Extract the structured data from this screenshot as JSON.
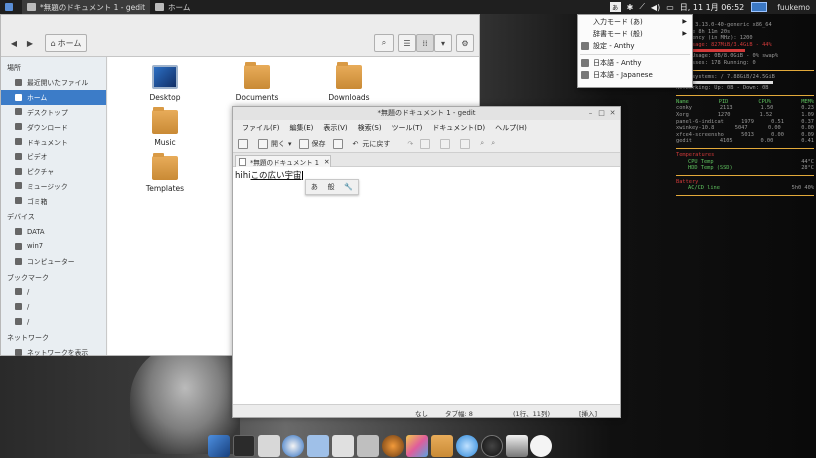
{
  "top_panel": {
    "tasks": [
      {
        "label": "*無題のドキュメント 1 - gedit",
        "active": true
      },
      {
        "label": "ホーム",
        "active": false
      }
    ],
    "ime_indicator": "あ",
    "clock": "日, 11 1月 06:52",
    "user": "fuukemo"
  },
  "ime_menu": {
    "items": [
      {
        "label": "入力モード (あ)",
        "submenu": true
      },
      {
        "label": "辞書モード (般)",
        "submenu": true
      },
      {
        "label": "設定 - Anthy",
        "submenu": false
      },
      {
        "label": "日本語 - Anthy",
        "submenu": false
      },
      {
        "label": "日本語 - Japanese",
        "submenu": false
      }
    ]
  },
  "file_manager": {
    "location_button": "ホーム",
    "sidebar": {
      "sections": [
        {
          "title": "場所",
          "items": [
            "最近開いたファイル",
            "ホーム",
            "デスクトップ",
            "ダウンロード",
            "ドキュメント",
            "ビデオ",
            "ピクチャ",
            "ミュージック",
            "ゴミ箱"
          ]
        },
        {
          "title": "デバイス",
          "items": [
            "DATA",
            "win7",
            "コンピューター"
          ]
        },
        {
          "title": "ブックマーク",
          "items": [
            "/",
            "/",
            "/"
          ]
        },
        {
          "title": "ネットワーク",
          "items": [
            "ネットワークを表示"
          ]
        }
      ],
      "selected": "ホーム"
    },
    "files": [
      "Desktop",
      "Documents",
      "Downloads",
      "Music",
      "Templates"
    ]
  },
  "gedit": {
    "title": "*無題のドキュメント 1 - gedit",
    "menu": [
      "ファイル(F)",
      "編集(E)",
      "表示(V)",
      "検索(S)",
      "ツール(T)",
      "ドキュメント(D)",
      "ヘルプ(H)"
    ],
    "toolbar": {
      "open": "開く",
      "save": "保存",
      "undo": "元に戻す"
    },
    "tab_label": "*無題のドキュメント 1",
    "text_committed": "hihi",
    "text_preedit": "この広い宇宙",
    "ime_popup": [
      "あ",
      "般"
    ],
    "status": {
      "language": "なし",
      "tab_width": "タブ幅: 8",
      "position": "(1行、11列)",
      "mode": "[挿入]"
    }
  },
  "conky": {
    "header": "Linux 3.13.0-40-generic x86_64",
    "lines": [
      "Uptime 8h 11m 20s",
      "Frequency (in MHz): 1200",
      "RAM Usage: 827MiB/3.4GiB - 44%",
      "Swap Usage: 0B/8.0GiB - 0% swap%",
      "Processes: 178  Running: 0"
    ],
    "disk": "File systems: / 7.88GiB/24.5GiB",
    "network": "Networking: Up: 0B  - Down: 0B",
    "procs_header": [
      "Name",
      "PID",
      "CPU%",
      "MEM%"
    ],
    "procs": [
      [
        "conky",
        "2113",
        "1.50",
        "0.23"
      ],
      [
        "Xorg",
        "1270",
        "1.52",
        "1.09"
      ],
      [
        "panel-6-indicat",
        "1979",
        "0.51",
        "0.37"
      ],
      [
        "xwinkey-10.8",
        "5047",
        "0.00",
        "0.00"
      ],
      [
        "xfce4-screensho",
        "5013",
        "0.00",
        "0.09"
      ],
      [
        "gedit",
        "4105",
        "0.00",
        "0.41"
      ]
    ],
    "temps_header": "Temperatures",
    "temps": [
      [
        "CPU Temp",
        "44°C"
      ],
      [
        "HDD Temp (SSD)",
        "28°C"
      ]
    ],
    "battery_header": "Battery",
    "battery": [
      "AC/CD line",
      "5h0 40%"
    ]
  }
}
